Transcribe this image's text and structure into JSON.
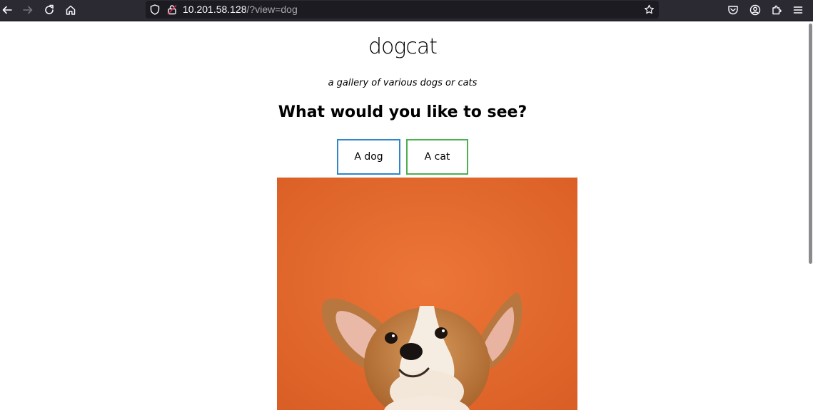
{
  "browser": {
    "url_host": "10.201.58.128",
    "url_path": "/?view=dog",
    "icons": {
      "back": "arrow-left-icon",
      "forward": "arrow-right-icon",
      "reload": "reload-icon",
      "home": "home-icon",
      "tracking": "shield-icon",
      "insecure": "lock-insecure-icon",
      "bookmark": "star-icon",
      "pocket": "pocket-icon",
      "account": "account-icon",
      "extensions": "puzzle-icon",
      "menu": "hamburger-icon"
    }
  },
  "page": {
    "title": "dogcat",
    "subtitle": "a gallery of various dogs or cats",
    "question": "What would you like to see?",
    "buttons": {
      "dog_label": "A dog",
      "cat_label": "A cat"
    },
    "colors": {
      "dog_border": "#2f87c8",
      "cat_border": "#4caf50",
      "photo_background": "#e46a2f"
    }
  }
}
